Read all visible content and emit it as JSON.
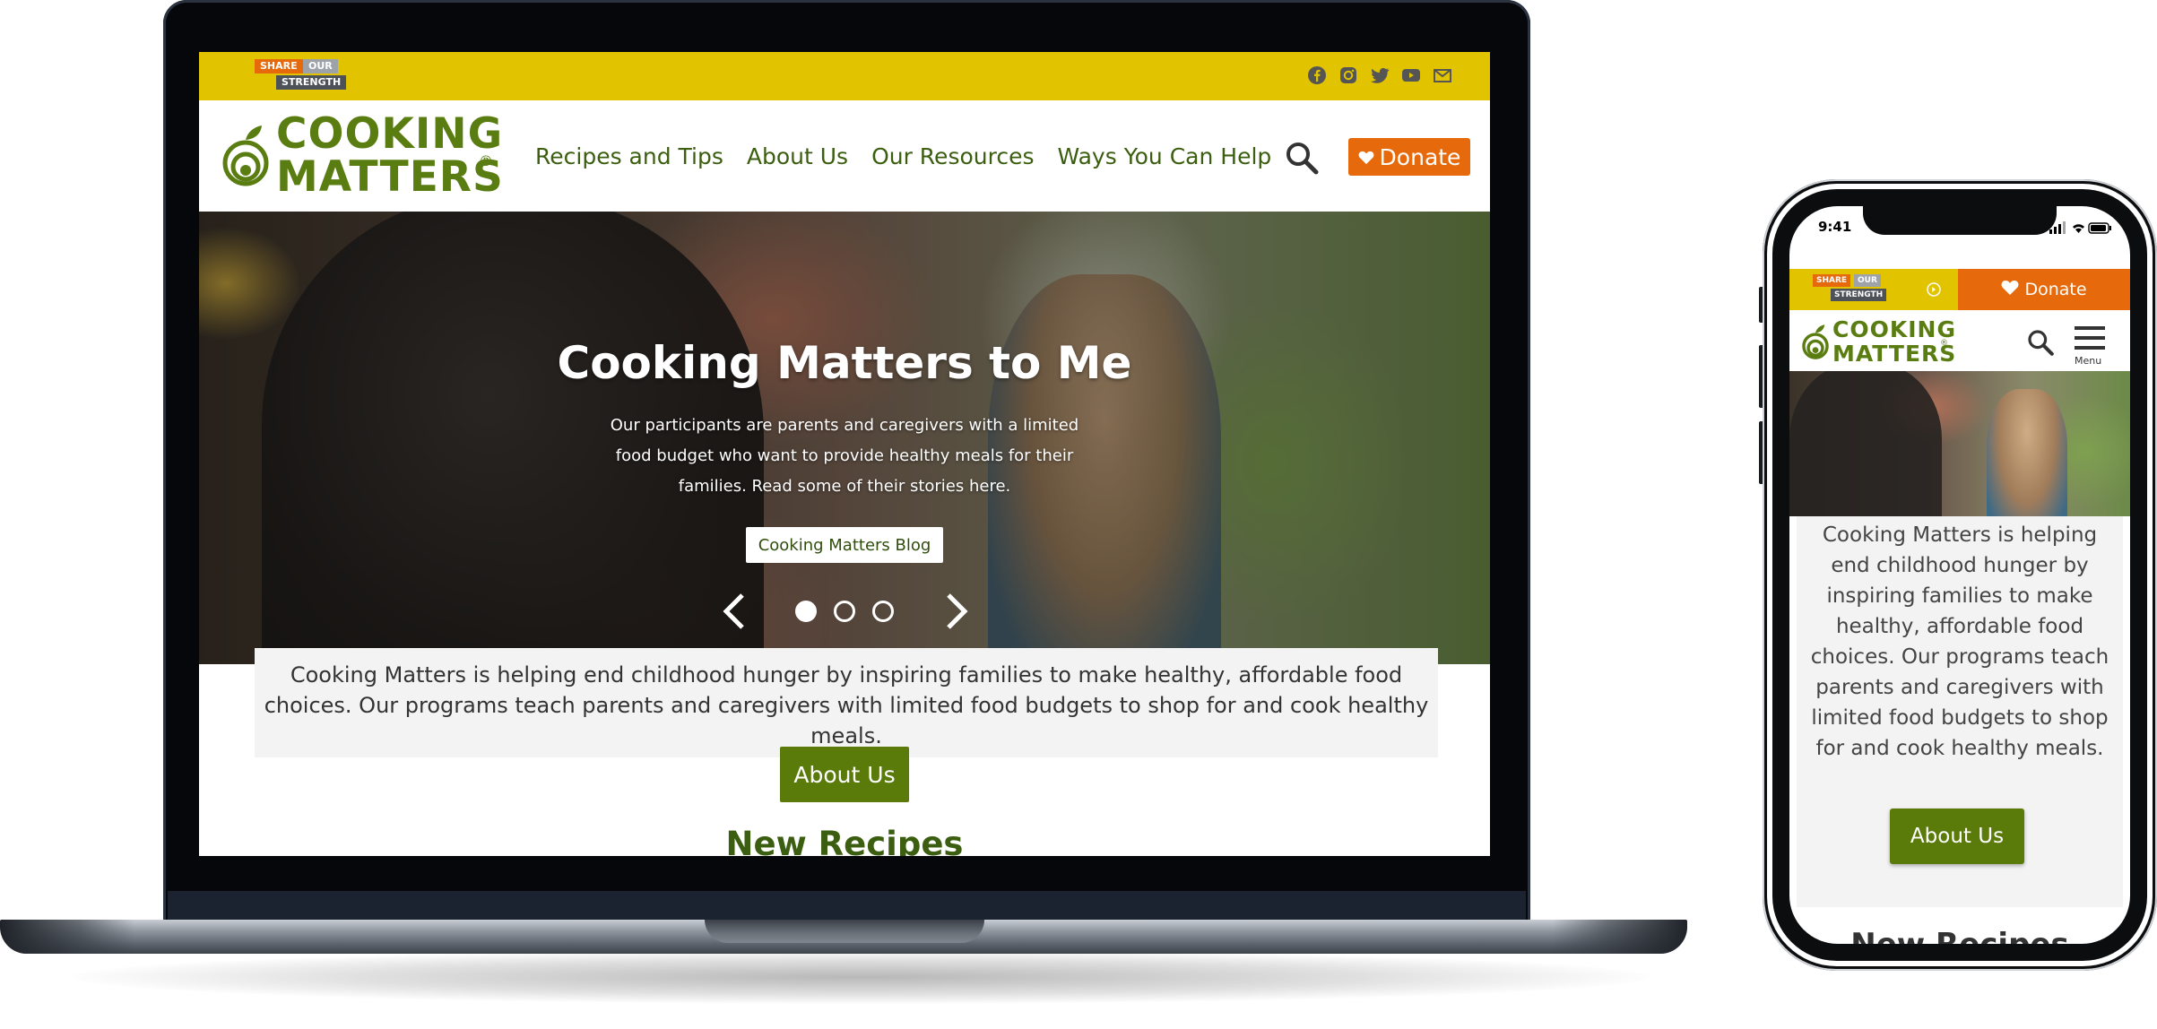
{
  "laptop": {
    "topbar": {
      "brand": {
        "share": "SHARE",
        "our": "OUR",
        "strength": "STRENGTH"
      },
      "social_icons": [
        "facebook-icon",
        "instagram-icon",
        "twitter-icon",
        "youtube-icon",
        "email-icon"
      ]
    },
    "header": {
      "logo_line1": "COOKING",
      "logo_line2": "MATTERS",
      "logo_reg": "®",
      "nav": [
        "Recipes and Tips",
        "About Us",
        "Our Resources",
        "Ways You Can Help"
      ],
      "donate_label": "Donate"
    },
    "hero": {
      "title": "Cooking Matters to Me",
      "subtitle": "Our participants are parents and caregivers with a limited food budget who want to provide healthy meals for their families. Read some of their stories here.",
      "button": "Cooking Matters Blog",
      "active_slide": 1,
      "slide_count": 3
    },
    "intro": "Cooking Matters is helping end childhood hunger by inspiring families to make healthy, affordable food choices. Our programs teach parents and caregivers with limited food budgets to shop for and cook healthy meals.",
    "about_button": "About Us",
    "section_heading": "New Recipes"
  },
  "phone": {
    "time": "9:41",
    "brand": {
      "share": "SHARE",
      "our": "OUR",
      "strength": "STRENGTH"
    },
    "donate_label": "Donate",
    "logo_line1": "COOKING",
    "logo_line2": "MATTERS",
    "logo_reg": "®",
    "menu_label": "Menu",
    "intro": "Cooking Matters is helping end childhood hunger by inspiring families to make healthy, affordable food choices. Our programs teach parents and caregivers with limited food budgets to shop for and cook healthy meals.",
    "about_button": "About Us",
    "section_heading": "New Recipes"
  },
  "colors": {
    "topbar_yellow": "#e1c300",
    "brand_green": "#5a7d12",
    "donate_orange": "#e66a0c",
    "about_green": "#5a7a0a"
  }
}
